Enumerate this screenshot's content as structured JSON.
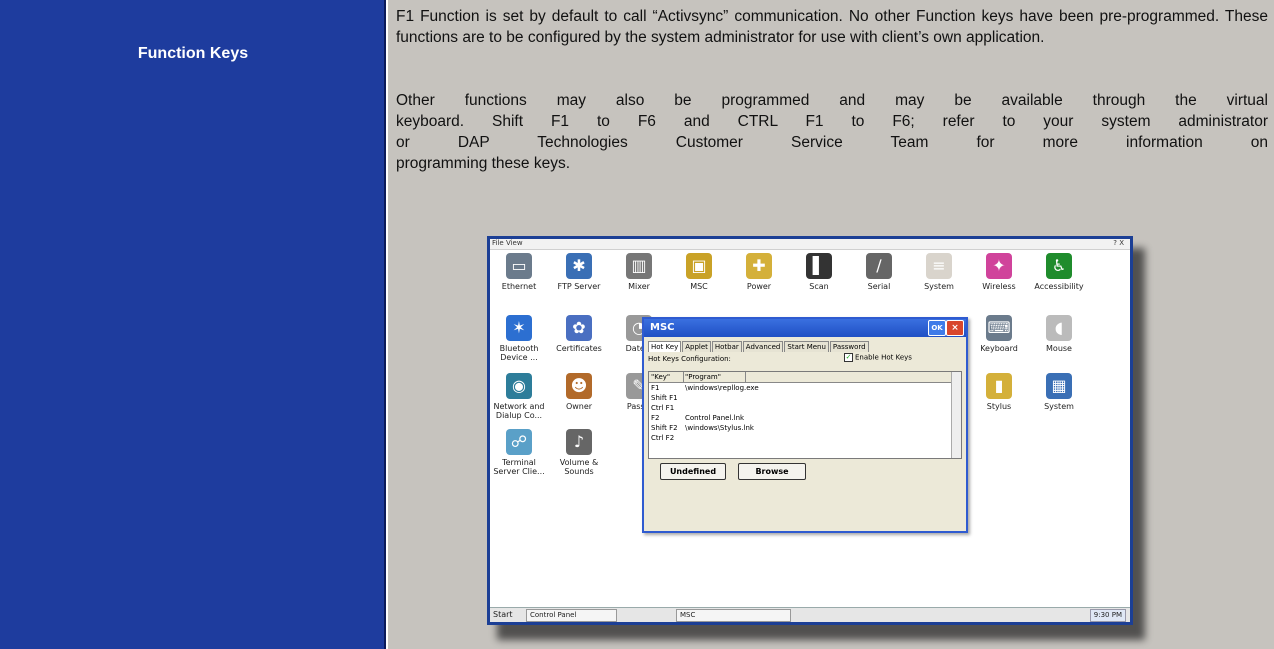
{
  "left": {
    "title": "Function Keys"
  },
  "para1": "F1 Function is set by default to call “Activsync” communication. No other Function keys have been pre-programmed. These functions are to be configured by the system administrator for use with client’s own application.",
  "para2_lines": [
    "Other functions may also be programmed and may be available through the virtual",
    "keyboard. Shift F1 to F6 and CTRL F1 to F6; refer to your system administrator",
    "or DAP Technologies Customer Service Team for more information on",
    "programming these keys."
  ],
  "screenshot": {
    "topbar_file": "File  View",
    "topbar_help": "? X",
    "icons": [
      {
        "label": "Ethernet",
        "symbol": "▭",
        "color": "#6b7b8c"
      },
      {
        "label": "FTP Server",
        "symbol": "✱",
        "color": "#3a6fb5"
      },
      {
        "label": "Mixer",
        "symbol": "▥",
        "color": "#777"
      },
      {
        "label": "MSC",
        "symbol": "▣",
        "color": "#c9a227"
      },
      {
        "label": "Power",
        "symbol": "✚",
        "color": "#d4b03a"
      },
      {
        "label": "Scan",
        "symbol": "▌",
        "color": "#333"
      },
      {
        "label": "Serial",
        "symbol": "∕",
        "color": "#666"
      },
      {
        "label": "System",
        "symbol": "≡",
        "color": "#d9d4cc"
      },
      {
        "label": "Wireless",
        "symbol": "✦",
        "color": "#d0439b"
      },
      {
        "label": "Accessibility",
        "symbol": "♿",
        "color": "#1f8c2c"
      },
      {
        "label": "Bluetooth Device ...",
        "symbol": "✶",
        "color": "#2c6fd1"
      },
      {
        "label": "Certificates",
        "symbol": "✿",
        "color": "#4a6fc1"
      },
      {
        "label": "Date/T",
        "symbol": "◔",
        "color": "#999"
      },
      {
        "label": "Keyboard",
        "symbol": "⌨",
        "color": "#6b7b8c"
      },
      {
        "label": "Mouse",
        "symbol": "◖",
        "color": "#bbb"
      },
      {
        "label": "Network and Dialup Co...",
        "symbol": "◉",
        "color": "#2d7d9a"
      },
      {
        "label": "Owner",
        "symbol": "☻",
        "color": "#b26a2a"
      },
      {
        "label": "Passw",
        "symbol": "✎",
        "color": "#999"
      },
      {
        "label": "Stylus",
        "symbol": "▮",
        "color": "#d4b03a"
      },
      {
        "label": "System",
        "symbol": "▦",
        "color": "#3a6fb5"
      },
      {
        "label": "Terminal Server Clie...",
        "symbol": "☍",
        "color": "#5aa0c8"
      },
      {
        "label": "Volume & Sounds",
        "symbol": "♪",
        "color": "#666"
      }
    ],
    "dialog": {
      "title": "MSC",
      "ok": "OK",
      "close": "×",
      "tabs": [
        "Hot Key",
        "Applet",
        "Hotbar",
        "Advanced",
        "Start Menu",
        "Password"
      ],
      "config_label": "Hot Keys Configuration:",
      "enable_label": "Enable Hot Keys",
      "enable_check": "✓",
      "col_key": "\"Key\"",
      "col_program": "\"Program\"",
      "rows": [
        {
          "key": "F1",
          "program": "\\windows\\repllog.exe"
        },
        {
          "key": "Shift F1",
          "program": ""
        },
        {
          "key": "Ctrl F1",
          "program": ""
        },
        {
          "key": "F2",
          "program": "Control Panel.lnk"
        },
        {
          "key": "Shift F2",
          "program": "\\windows\\Stylus.lnk"
        },
        {
          "key": "Ctrl F2",
          "program": ""
        }
      ],
      "btn_undefined": "Undefined",
      "btn_browse": "Browse"
    },
    "taskbar": {
      "start": "Start",
      "task1": "Control Panel",
      "task2": "MSC",
      "tray": "9:30 PM"
    }
  }
}
